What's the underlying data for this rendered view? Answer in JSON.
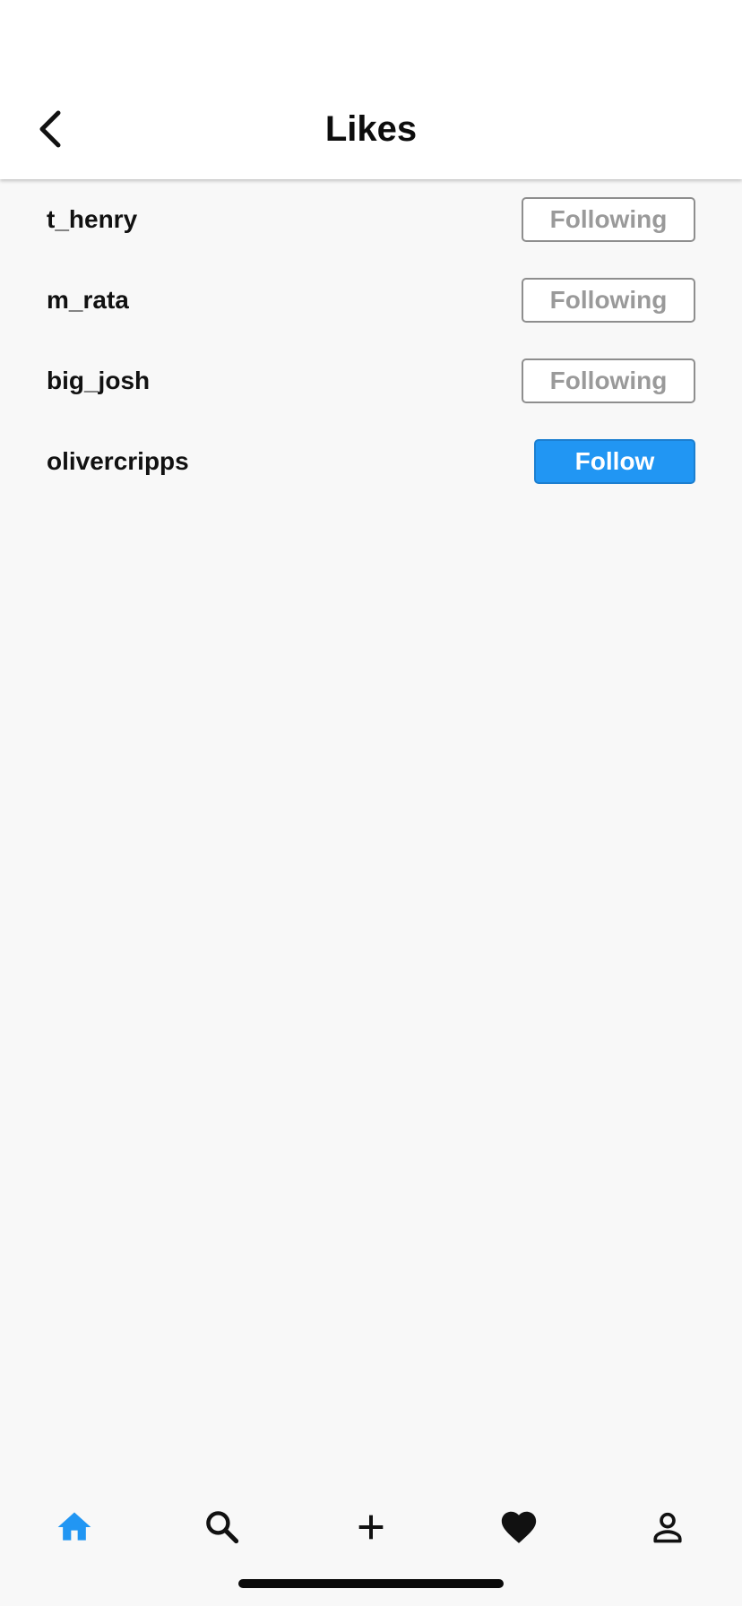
{
  "header": {
    "title": "Likes",
    "back_icon": "chevron-left-icon"
  },
  "likes": [
    {
      "username": "t_henry",
      "button_label": "Following",
      "state": "following"
    },
    {
      "username": "m_rata",
      "button_label": "Following",
      "state": "following"
    },
    {
      "username": "big_josh",
      "button_label": "Following",
      "state": "following"
    },
    {
      "username": "olivercripps",
      "button_label": "Follow",
      "state": "not-following"
    }
  ],
  "tabbar": {
    "items": [
      {
        "icon": "home-icon",
        "active": true
      },
      {
        "icon": "search-icon",
        "active": false
      },
      {
        "icon": "plus-icon",
        "active": false
      },
      {
        "icon": "heart-icon",
        "active": false
      },
      {
        "icon": "person-icon",
        "active": false
      }
    ]
  },
  "colors": {
    "accent": "#2196F3",
    "background": "#F8F8F8",
    "header_background": "#FFFFFF",
    "following_text": "#9A9A9A",
    "text": "#111111"
  }
}
